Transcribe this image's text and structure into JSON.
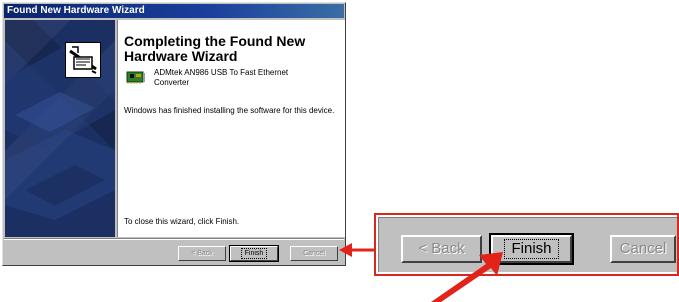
{
  "window": {
    "title": "Found New Hardware Wizard"
  },
  "content": {
    "heading_line1": "Completing the Found New",
    "heading_line2": "Hardware Wizard",
    "device_line1": "ADMtek AN986 USB To Fast Ethernet",
    "device_line2": "Converter",
    "status": "Windows has finished installing the software for this device.",
    "close_hint": "To close this wizard, click Finish."
  },
  "buttons": {
    "back": "< Back",
    "finish": "Finish",
    "cancel": "Cancel"
  },
  "icons": {
    "wizard": "wizard-install-icon",
    "device": "network-card-icon",
    "arrow": "red-pointer-arrow"
  },
  "colors": {
    "titlebar": "#0a246a",
    "banner": "#1b2f63",
    "callout_border": "#d8271f",
    "arrow": "#e2231a",
    "face": "#c0c0c0"
  }
}
